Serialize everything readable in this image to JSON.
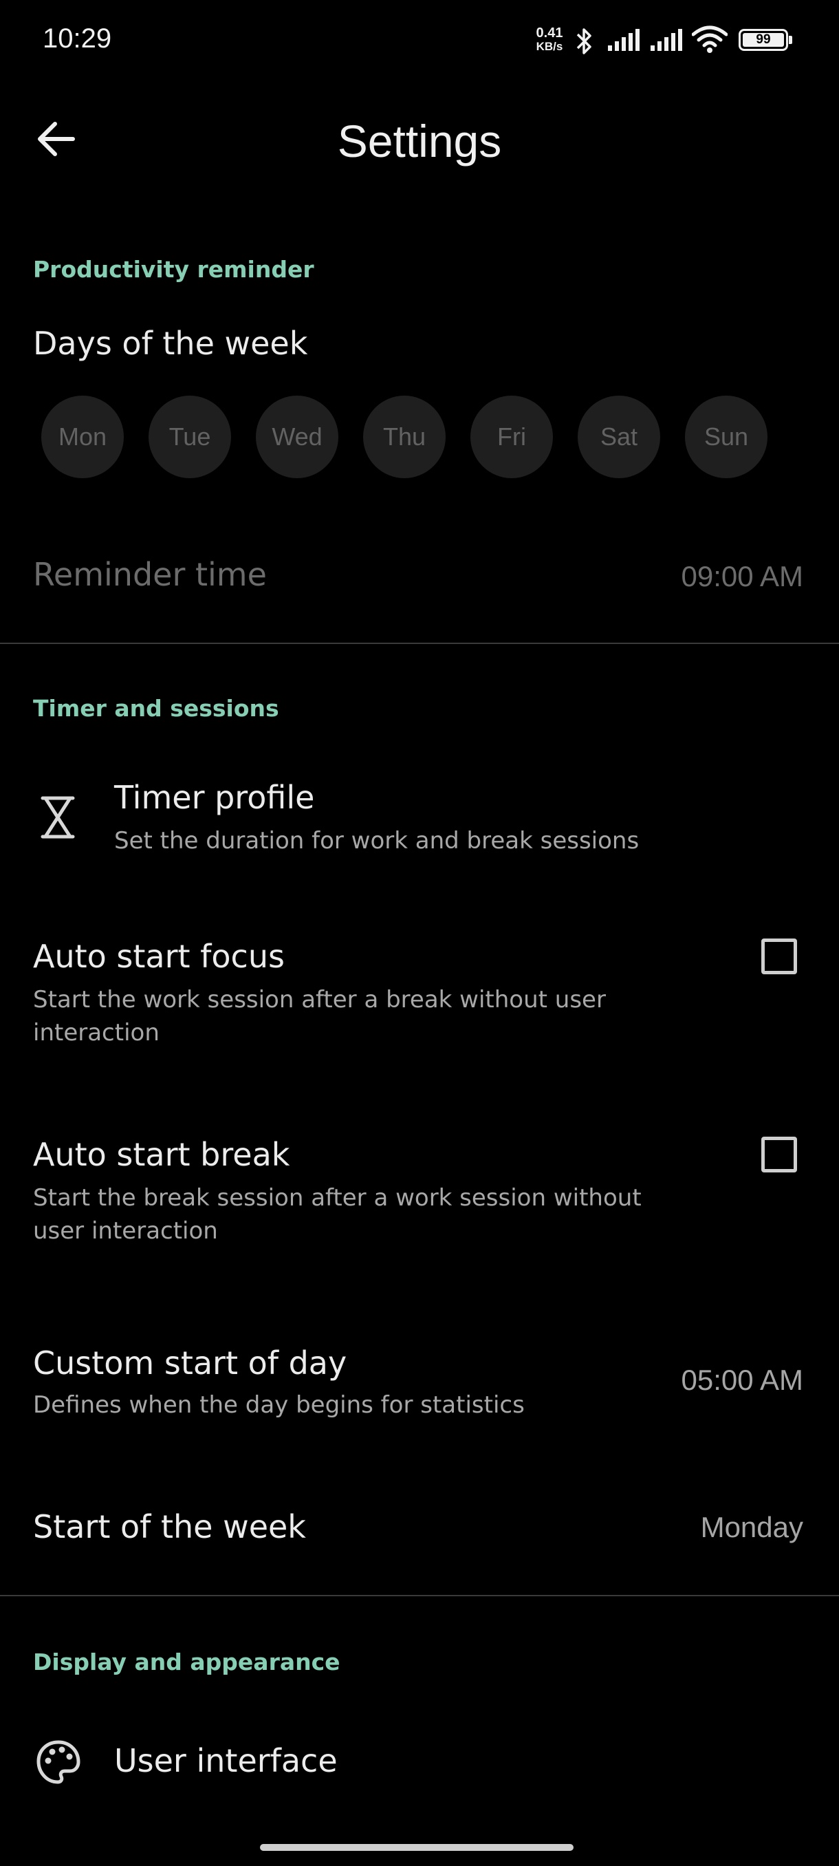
{
  "status_bar": {
    "time": "10:29",
    "net_speed_value": "0.41",
    "net_speed_unit": "KB/s",
    "battery": "99"
  },
  "app_bar": {
    "title": "Settings",
    "back_icon": "arrow-left-icon"
  },
  "productivity": {
    "header": "Productivity reminder",
    "days_label": "Days of the week",
    "days": [
      "Mon",
      "Tue",
      "Wed",
      "Thu",
      "Fri",
      "Sat",
      "Sun"
    ],
    "reminder_label": "Reminder time",
    "reminder_value": "09:00 AM"
  },
  "timer": {
    "header": "Timer and sessions",
    "profile_title": "Timer profile",
    "profile_sub": "Set the duration for work and break sessions",
    "profile_icon": "hourglass-icon",
    "focus_title": "Auto start focus",
    "focus_sub_1": "Start the work session after a break without user",
    "focus_sub_2": "interaction",
    "break_title": "Auto start break",
    "break_sub_1": "Start the break session after a work session without",
    "break_sub_2": "user interaction",
    "custom_day_title": "Custom start of day",
    "custom_day_sub": "Defines when the day begins for statistics",
    "custom_day_value": "05:00 AM",
    "week_start_title": "Start of the week",
    "week_start_value": "Monday"
  },
  "display": {
    "header": "Display and appearance",
    "ui_title": "User interface",
    "ui_icon": "palette-icon"
  },
  "colors": {
    "accent": "#86ceb4",
    "background": "#000000"
  }
}
